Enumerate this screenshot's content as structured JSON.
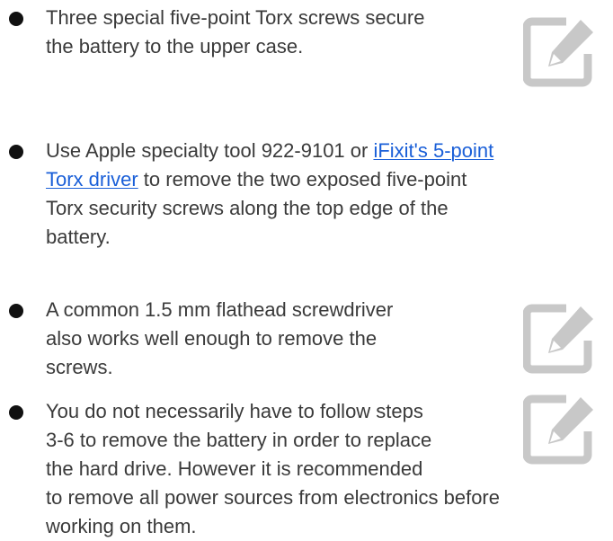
{
  "bullets": [
    {
      "lines": [
        "Three special five-point Torx screws secure",
        "the battery to the upper case."
      ],
      "has_edit_icon": true,
      "bullet_icon": "bullet-dot-icon",
      "edit_icon": "edit-note-icon"
    },
    {
      "line1_prefix": "Use Apple specialty tool 922-9101 or ",
      "link_text": "iFixit's 5-point Torx driver",
      "link_line1": "iFixit's 5-point",
      "link_line2": "Torx driver",
      "line2_suffix": " to remove the two exposed five-point",
      "lines_rest": [
        "Torx security screws along the top edge of the",
        "battery."
      ],
      "has_edit_icon": false,
      "bullet_icon": "bullet-dot-icon"
    },
    {
      "lines": [
        "A common 1.5 mm flathead screwdriver",
        "also works well enough to remove the",
        "screws."
      ],
      "has_edit_icon": true,
      "bullet_icon": "bullet-dot-icon",
      "edit_icon": "edit-note-icon"
    },
    {
      "lines": [
        "You do not necessarily have to follow steps",
        "3-6 to remove the battery in order to replace",
        "the hard drive. However it is recommended",
        "to remove all power sources from electronics before",
        "working on them."
      ],
      "has_edit_icon": true,
      "bullet_icon": "bullet-dot-icon",
      "edit_icon": "edit-note-icon"
    }
  ],
  "colors": {
    "text": "#3a3a3a",
    "bullet": "#111111",
    "link": "#1a5fd8",
    "icon": "#c8c8c8"
  }
}
